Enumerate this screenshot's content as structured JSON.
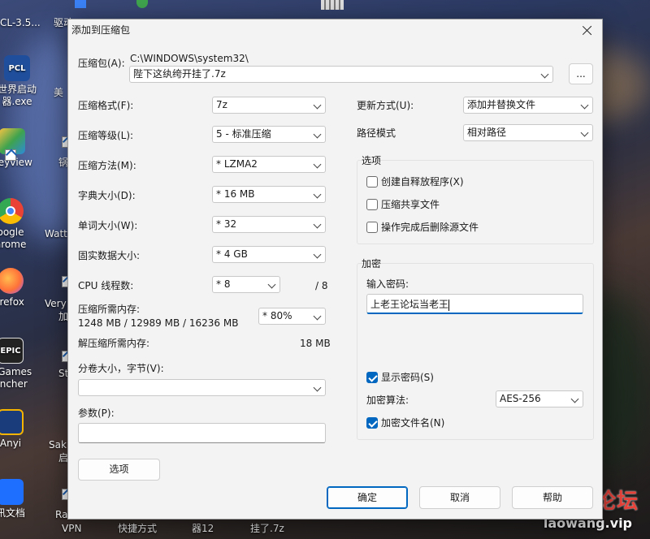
{
  "desktop": {
    "top_labels": [
      "CL-3.5...",
      "驱动",
      "",
      "",
      "",
      ""
    ],
    "icons_left": [
      {
        "name": "pcl-icon",
        "badge": "PCL",
        "lines": [
          "世界启动",
          "器.exe"
        ],
        "color": "#1f4f9c"
      },
      {
        "name": "honeyview-icon",
        "badge": "",
        "lines": [
          "neyview"
        ],
        "color": "#2d8ad8"
      },
      {
        "name": "chrome-icon",
        "badge": "",
        "lines": [
          "oogle",
          "hrome"
        ],
        "color": "#ffffff"
      },
      {
        "name": "firefox-icon",
        "badge": "",
        "lines": [
          "irefox"
        ],
        "color": "#ff7139"
      },
      {
        "name": "epic-games-icon",
        "badge": "EPIC",
        "lines": [
          "c Games",
          "uncher"
        ],
        "color": "#222222"
      },
      {
        "name": "anyi-icon",
        "badge": "",
        "lines": [
          "Anyi"
        ],
        "color": "#2563c7"
      },
      {
        "name": "tencent-docs-icon",
        "badge": "",
        "lines": [
          "讯文档"
        ],
        "color": "#1e6fff"
      }
    ],
    "icons_mid_labels": [
      "美",
      "锅",
      "Watt",
      "Very",
      "加",
      "St",
      "Sak",
      "启",
      "Ra",
      "VPN"
    ],
    "taskbar_labels": [
      "快捷方式",
      "器12",
      "挂了.7z"
    ],
    "watermark_main": "老王论坛",
    "watermark_sub": "laowang.vip"
  },
  "dialog": {
    "title": "添加到压缩包",
    "archive": {
      "label": "压缩包(A):",
      "path": "C:\\WINDOWS\\system32\\",
      "filename": "陛下这纨绔开挂了.7z",
      "browse_label": "..."
    },
    "left": {
      "format": {
        "label": "压缩格式(F):",
        "value": "7z"
      },
      "level": {
        "label": "压缩等级(L):",
        "value": "5 - 标准压缩"
      },
      "method": {
        "label": "压缩方法(M):",
        "value": "* LZMA2"
      },
      "dict": {
        "label": "字典大小(D):",
        "value": "* 16 MB"
      },
      "word": {
        "label": "单词大小(W):",
        "value": "* 32"
      },
      "solid": {
        "label": "固实数据大小:",
        "value": "* 4 GB"
      },
      "cpu": {
        "label": "CPU 线程数:",
        "value": "* 8",
        "max": "/ 8"
      },
      "mem": {
        "label": "压缩所需内存:",
        "detail": "1248 MB / 12989 MB / 16236 MB",
        "value": "* 80%"
      },
      "decomp": {
        "label": "解压缩所需内存:",
        "value": "18 MB"
      },
      "split": {
        "label": "分卷大小，字节(V):",
        "value": ""
      },
      "params": {
        "label": "参数(P):",
        "value": ""
      },
      "options_button": "选项"
    },
    "right": {
      "update": {
        "label": "更新方式(U):",
        "value": "添加并替换文件"
      },
      "pathmode": {
        "label": "路径模式",
        "value": "相对路径"
      },
      "options_group": {
        "title": "选项",
        "items": [
          {
            "label": "创建自释放程序(X)",
            "checked": false
          },
          {
            "label": "压缩共享文件",
            "checked": false
          },
          {
            "label": "操作完成后删除源文件",
            "checked": false
          }
        ]
      },
      "encryption": {
        "title": "加密",
        "password_label": "输入密码:",
        "password_value": "上老王论坛当老王",
        "show_password": {
          "label": "显示密码(S)",
          "checked": true
        },
        "method_label": "加密算法:",
        "method_value": "AES-256",
        "encrypt_names": {
          "label": "加密文件名(N)",
          "checked": true
        }
      }
    },
    "buttons": {
      "ok": "确定",
      "cancel": "取消",
      "help": "帮助"
    }
  }
}
